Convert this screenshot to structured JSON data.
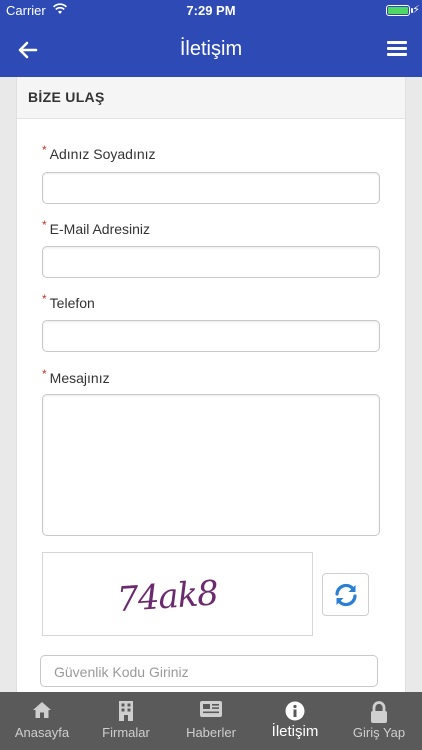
{
  "status": {
    "carrier": "Carrier",
    "time": "7:29 PM"
  },
  "nav": {
    "title": "İletişim"
  },
  "card": {
    "header": "BİZE ULAŞ"
  },
  "form": {
    "required_mark": "*",
    "name_label": "Adınız Soyadınız",
    "email_label": "E-Mail Adresiniz",
    "phone_label": "Telefon",
    "message_label": "Mesajınız",
    "name_value": "",
    "email_value": "",
    "phone_value": "",
    "message_value": "",
    "captcha_text": "74ak8",
    "security_placeholder": "Güvenlik Kodu Giriniz"
  },
  "tabs": [
    {
      "label": "Anasayfa",
      "icon": "home-icon"
    },
    {
      "label": "Firmalar",
      "icon": "building-icon"
    },
    {
      "label": "Haberler",
      "icon": "newspaper-icon"
    },
    {
      "label": "İletişim",
      "icon": "info-icon",
      "active": true
    },
    {
      "label": "Giriş Yap",
      "icon": "lock-icon"
    }
  ],
  "colors": {
    "nav": "#2e4bb5",
    "tabbar": "#5a5a5a",
    "captcha": "#6b2a6e",
    "refresh": "#2a7fd4",
    "required": "#c0392b"
  }
}
